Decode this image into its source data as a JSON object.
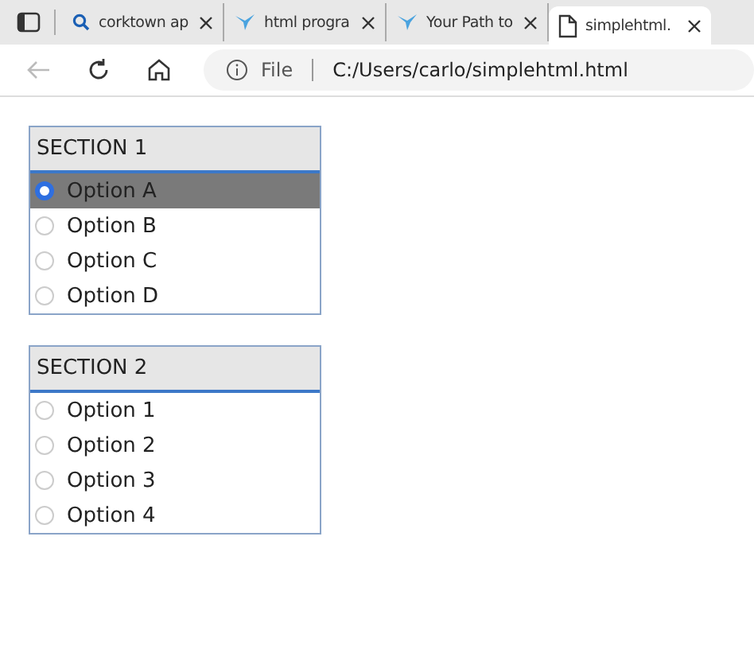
{
  "tabs": [
    {
      "kind": "search",
      "title": "corktown ap",
      "selected": false
    },
    {
      "kind": "bird",
      "title": "html progra",
      "selected": false
    },
    {
      "kind": "bird",
      "title": "Your Path to",
      "selected": false
    },
    {
      "kind": "file",
      "title": "simplehtml.",
      "selected": true
    }
  ],
  "address_bar": {
    "label": "File",
    "url": "C:/Users/carlo/simplehtml.html"
  },
  "sections": [
    {
      "title": "SECTION 1",
      "options": [
        {
          "label": "Option A",
          "selected": true
        },
        {
          "label": "Option B",
          "selected": false
        },
        {
          "label": "Option C",
          "selected": false
        },
        {
          "label": "Option D",
          "selected": false
        }
      ]
    },
    {
      "title": "SECTION 2",
      "options": [
        {
          "label": "Option 1",
          "selected": false
        },
        {
          "label": "Option 2",
          "selected": false
        },
        {
          "label": "Option 3",
          "selected": false
        },
        {
          "label": "Option 4",
          "selected": false
        }
      ]
    }
  ]
}
